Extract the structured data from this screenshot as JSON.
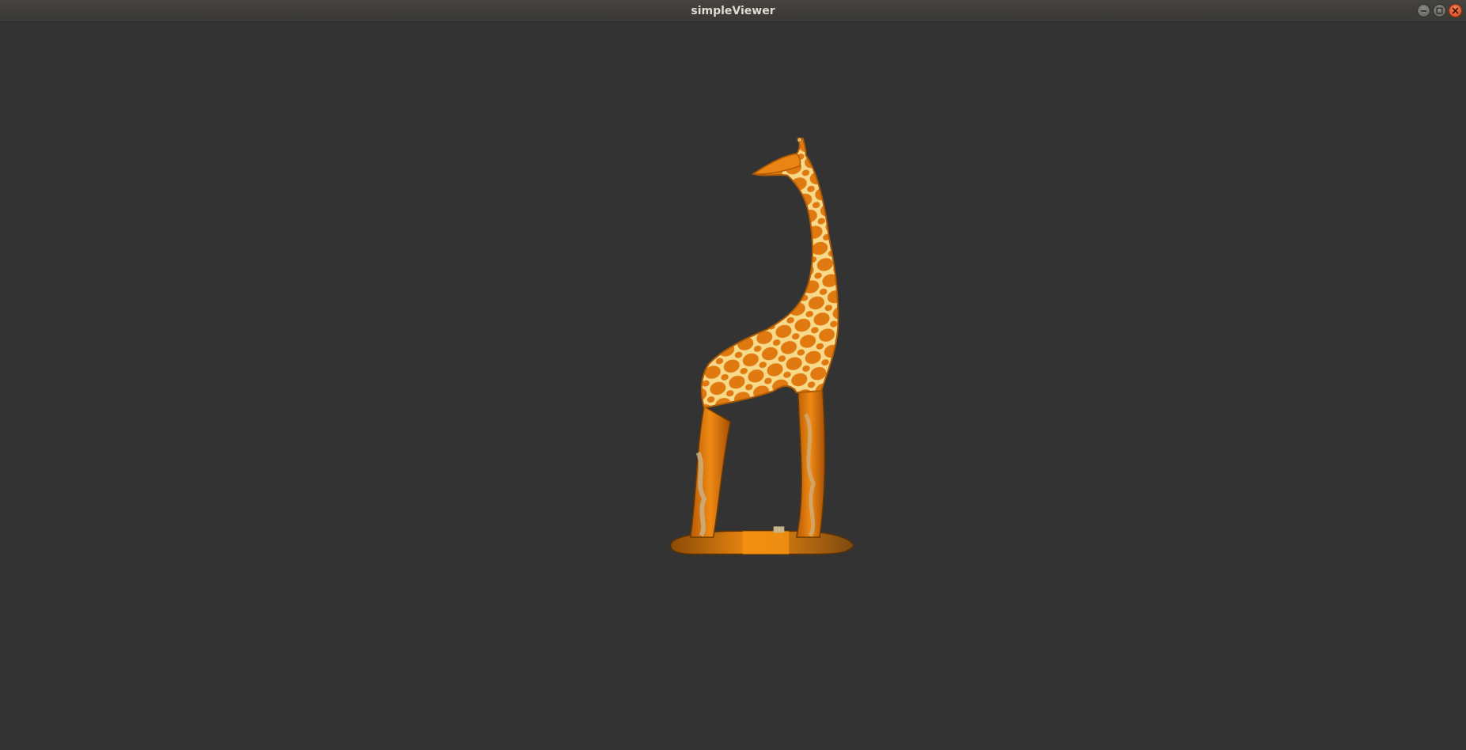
{
  "window": {
    "title": "simpleViewer",
    "controls": {
      "minimize_icon": "minimize-icon",
      "maximize_icon": "maximize-icon",
      "close_icon": "close-icon"
    }
  },
  "viewport": {
    "background_color": "#333333",
    "model": {
      "kind": "giraffe-figurine",
      "primary_color": "#e07a10",
      "pattern_color": "#f7d98a"
    }
  }
}
